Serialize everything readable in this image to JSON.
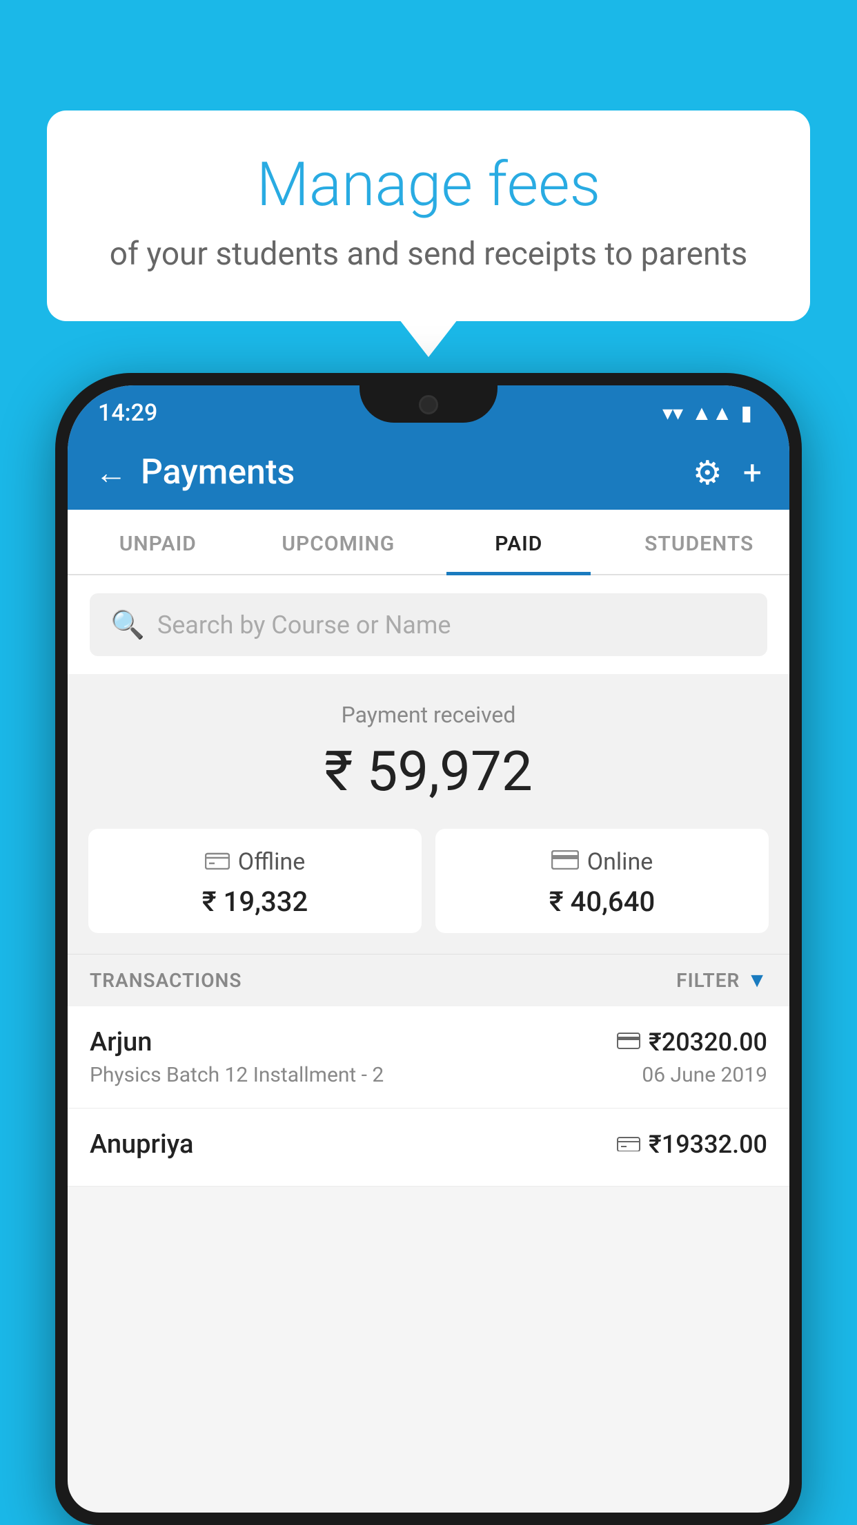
{
  "background_color": "#1bb8e8",
  "speech_bubble": {
    "title": "Manage fees",
    "subtitle": "of your students and send receipts to parents"
  },
  "status_bar": {
    "time": "14:29",
    "wifi": "▼",
    "signal": "▲",
    "battery": "▮"
  },
  "header": {
    "title": "Payments",
    "back_label": "←",
    "gear_label": "⚙",
    "plus_label": "+"
  },
  "tabs": [
    {
      "label": "UNPAID",
      "active": false
    },
    {
      "label": "UPCOMING",
      "active": false
    },
    {
      "label": "PAID",
      "active": true
    },
    {
      "label": "STUDENTS",
      "active": false
    }
  ],
  "search": {
    "placeholder": "Search by Course or Name"
  },
  "payment_received": {
    "label": "Payment received",
    "total": "₹ 59,972",
    "offline": {
      "type": "Offline",
      "amount": "₹ 19,332"
    },
    "online": {
      "type": "Online",
      "amount": "₹ 40,640"
    }
  },
  "transactions": {
    "header_label": "TRANSACTIONS",
    "filter_label": "FILTER",
    "rows": [
      {
        "name": "Arjun",
        "course": "Physics Batch 12 Installment - 2",
        "amount": "₹20320.00",
        "date": "06 June 2019",
        "type": "online"
      },
      {
        "name": "Anupriya",
        "course": "",
        "amount": "₹19332.00",
        "date": "",
        "type": "offline"
      }
    ]
  }
}
